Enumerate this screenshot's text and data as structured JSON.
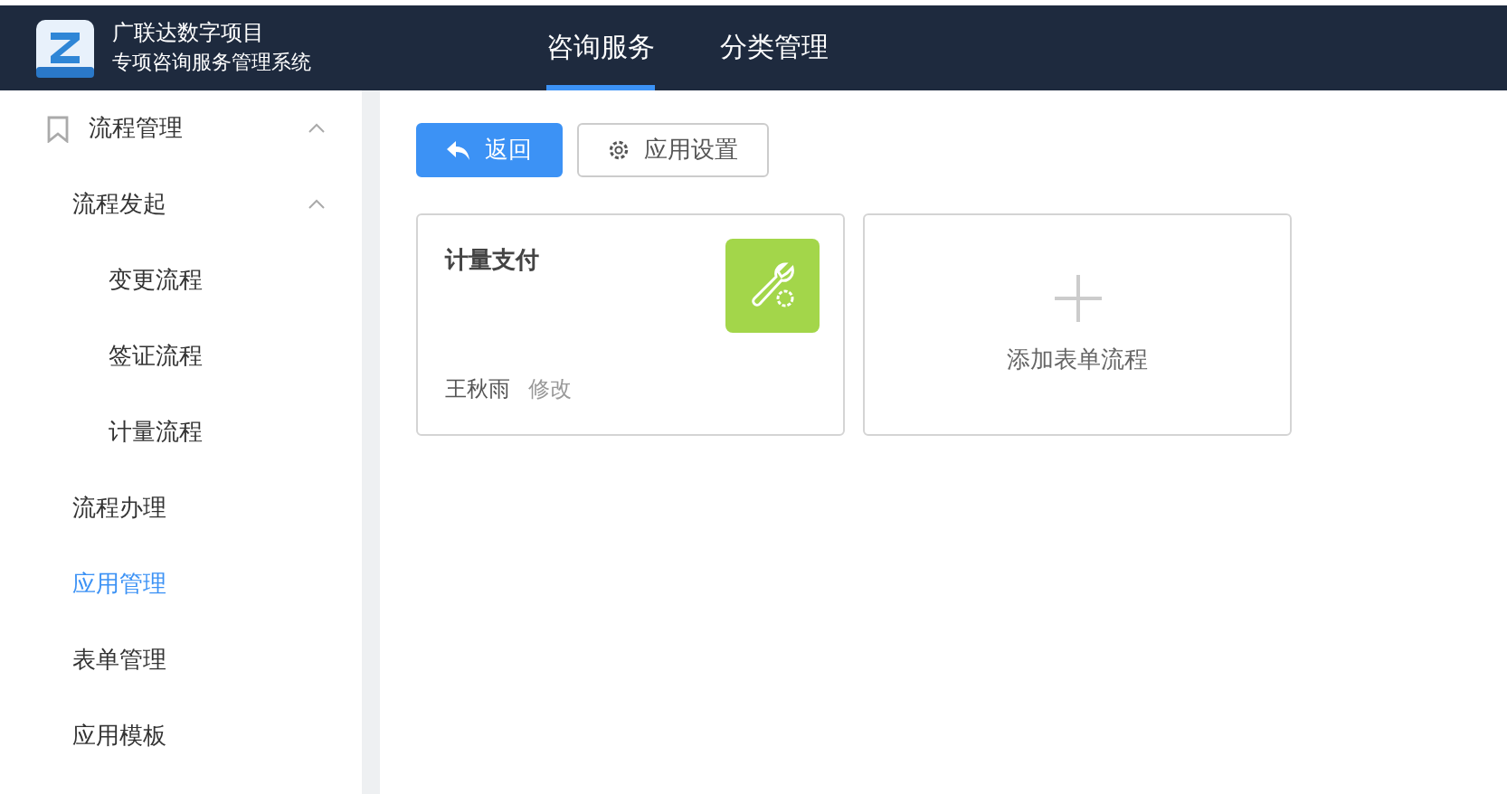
{
  "header": {
    "title": "广联达数字项目",
    "subtitle": "专项咨询服务管理系统"
  },
  "nav": [
    {
      "label": "咨询服务",
      "selected": true
    },
    {
      "label": "分类管理",
      "selected": false
    }
  ],
  "sidebar": {
    "items": [
      {
        "label": "流程管理",
        "expanded": true,
        "selected": false,
        "children": [
          {
            "label": "流程发起",
            "expanded": true,
            "selected": false,
            "children": [
              {
                "label": "变更流程",
                "selected": false
              },
              {
                "label": "签证流程",
                "selected": false
              },
              {
                "label": "计量流程",
                "selected": false
              }
            ]
          },
          {
            "label": "流程办理",
            "selected": false
          },
          {
            "label": "应用管理",
            "selected": true
          },
          {
            "label": "表单管理",
            "selected": false
          },
          {
            "label": "应用模板",
            "selected": false
          }
        ]
      }
    ]
  },
  "toolbar": {
    "back": "返回",
    "settings": "应用设置"
  },
  "cards": [
    {
      "kind": "app",
      "title": "计量支付",
      "owner": "王秋雨",
      "action": "修改"
    },
    {
      "kind": "add",
      "label": "添加表单流程"
    }
  ]
}
